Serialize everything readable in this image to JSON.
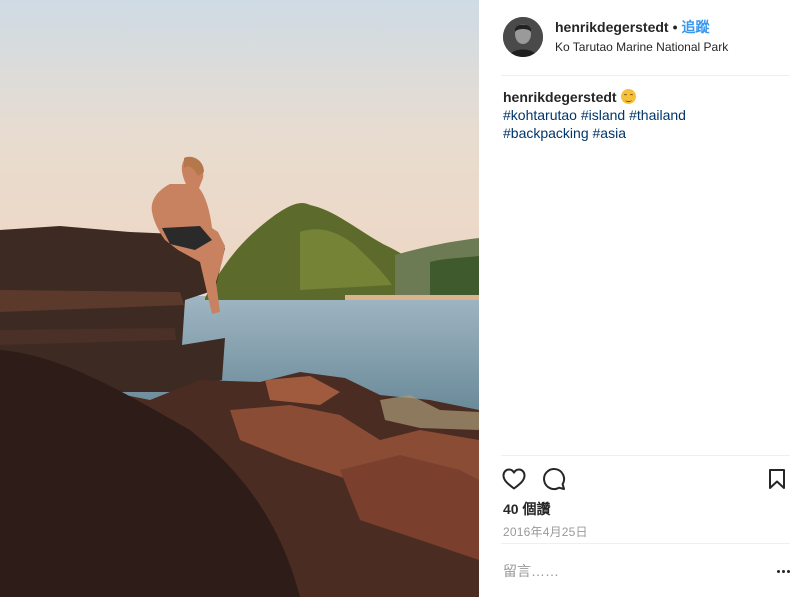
{
  "post": {
    "image_alt": "Person sitting on rocks looking at an island",
    "colors": {
      "link": "#3897f0",
      "hashtag": "#003569",
      "muted": "#999999"
    }
  },
  "header": {
    "username": "henrikdegerstedt",
    "separator": "•",
    "follow_label": "追蹤",
    "location": "Ko Tarutao Marine National Park",
    "avatar_icon": "profile-photo"
  },
  "caption": {
    "username": "henrikdegerstedt",
    "emoji": "smiling-face-emoji",
    "hashtags": [
      "#kohtarutao",
      "#island",
      "#thailand",
      "#backpacking",
      "#asia"
    ]
  },
  "actions": {
    "like_icon": "heart-icon",
    "comment_icon": "comment-icon",
    "save_icon": "bookmark-icon"
  },
  "likes": "40 個讚",
  "date": "2016年4月25日",
  "comment": {
    "placeholder": "留言……",
    "more_icon": "ellipsis-icon"
  }
}
